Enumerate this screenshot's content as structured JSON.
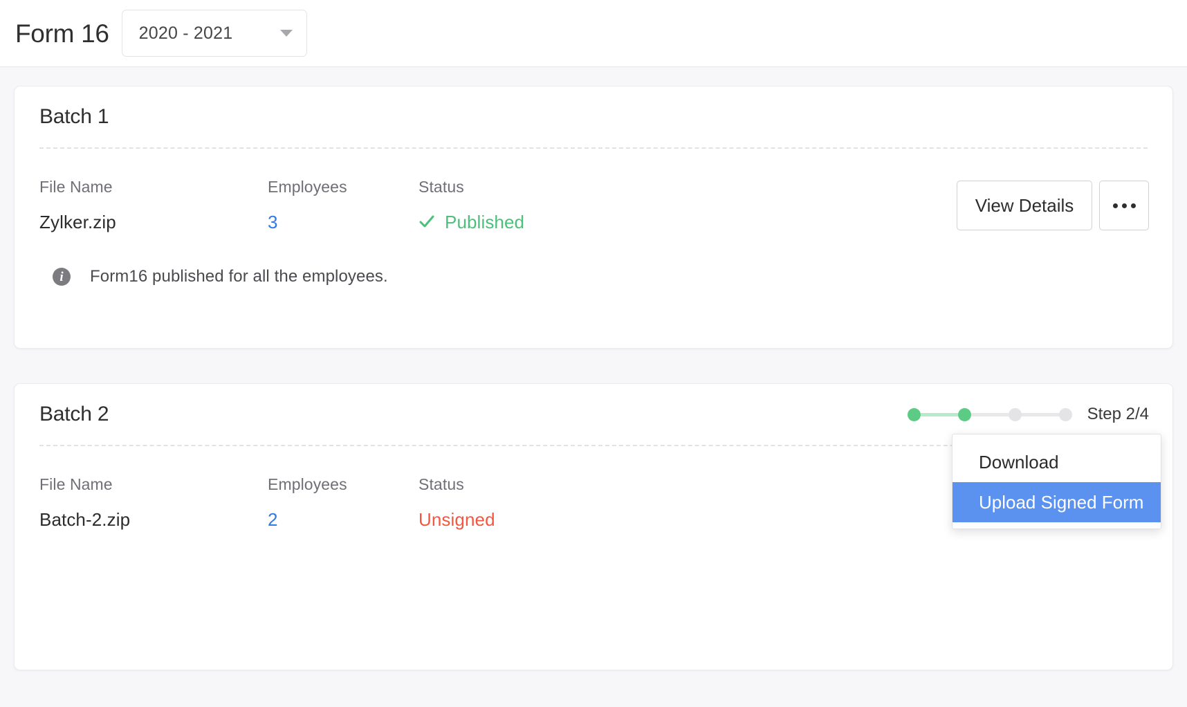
{
  "header": {
    "title": "Form 16",
    "year_selector": {
      "value": "2020 - 2021",
      "icon": "chevron-down-icon"
    }
  },
  "columns": {
    "file_name": "File Name",
    "employees": "Employees",
    "status": "Status"
  },
  "actions": {
    "view_details": "View Details",
    "more_icon": "ellipsis-icon"
  },
  "colors": {
    "published_green": "#4cc07b",
    "unsigned_red": "#f4573f",
    "link_blue": "#2f7ae5",
    "menu_highlight_blue": "#5b92f0",
    "step_done_green": "#5ccb84",
    "step_todo_gray": "#e4e4e6"
  },
  "batches": [
    {
      "title": "Batch 1",
      "file_name": "Zylker.zip",
      "employees": "3",
      "status": "Published",
      "status_type": "published",
      "status_icon": "check-icon",
      "note": {
        "icon": "info-icon",
        "text": "Form16 published for all the employees."
      },
      "menu_open": false
    },
    {
      "title": "Batch 2",
      "file_name": "Batch-2.zip",
      "employees": "2",
      "status": "Unsigned",
      "status_type": "unsigned",
      "stepper": {
        "label": "Step 2/4",
        "total": 4,
        "current": 2
      },
      "menu_open": true,
      "menu_items": [
        {
          "label": "Download",
          "highlighted": false
        },
        {
          "label": "Upload Signed Form",
          "highlighted": true
        }
      ]
    }
  ]
}
